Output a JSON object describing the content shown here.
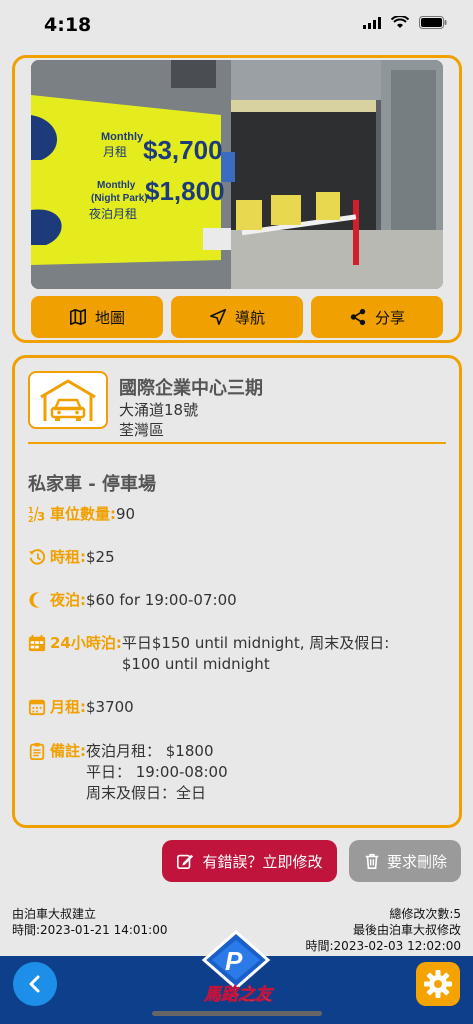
{
  "status_bar": {
    "time": "4:18"
  },
  "photo": {
    "sign_monthly_label": "Monthly",
    "sign_monthly_cn": "月租",
    "sign_monthly_price": "$3,700",
    "sign_night_label_1": "Monthly",
    "sign_night_label_2": "(Night Park)",
    "sign_night_cn": "夜泊月租",
    "sign_night_price": "$1,800"
  },
  "actions": {
    "map_label": "地圖",
    "navigate_label": "導航",
    "share_label": "分享"
  },
  "carpark": {
    "name": "國際企業中心三期",
    "address": "大涌道18號",
    "district": "荃灣區",
    "type_title": "私家車 - 停車場"
  },
  "details": {
    "spaces_label": "車位數量:",
    "spaces_value": "90",
    "hourly_label": "時租:",
    "hourly_value": "$25",
    "night_label": "夜泊:",
    "night_value": "$60 for 19:00-07:00",
    "day24_label": "24小時泊:",
    "day24_value_line1": "平日$150 until midnight, 周末及假日:",
    "day24_value_line2": "$100 until midnight",
    "monthly_label": "月租:",
    "monthly_value": "$3700",
    "remarks_label": "備註:",
    "remarks_line1": "夜泊月租： $1800",
    "remarks_line2": "平日： 19:00-08:00",
    "remarks_line3": "周末及假日：全日"
  },
  "buttons": {
    "edit_label": "有錯誤？立即修改",
    "delete_label": "要求刪除"
  },
  "meta": {
    "created_by": "由泊車大叔建立",
    "created_time": "時間:2023-01-21 14:01:00",
    "edit_count": "總修改次數:5",
    "last_edited_by": "最後由泊車大叔修改",
    "last_edited_time": "時間:2023-02-03 12:02:00"
  },
  "logo": {
    "text": "馬路之友"
  },
  "colors": {
    "accent": "#f0a000",
    "danger": "#c0143c",
    "bottom_bar": "#0d3f8a"
  }
}
